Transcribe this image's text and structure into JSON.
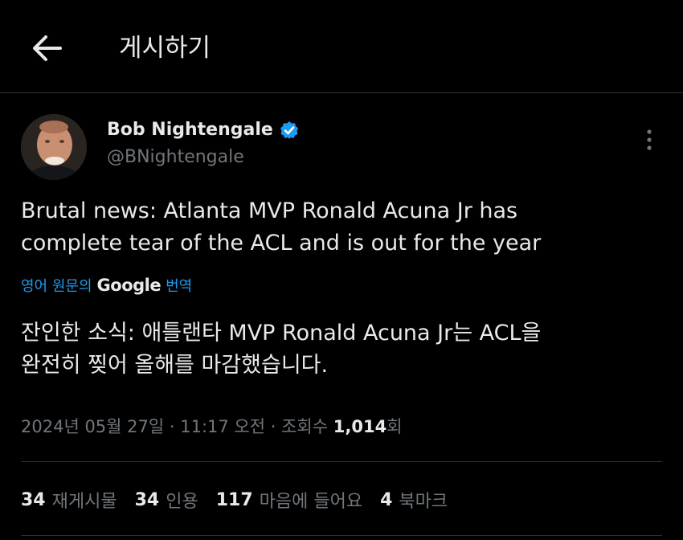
{
  "header": {
    "title": "게시하기",
    "back_icon": "arrow-left-icon"
  },
  "author": {
    "name": "Bob Nightengale",
    "handle": "@BNightengale",
    "verified_icon": "verified-badge-icon",
    "verified_color": "#1d9bf0"
  },
  "tweet": {
    "text_line1": "Brutal news: Atlanta MVP Ronald Acuna Jr has",
    "text_line2": "complete tear of the ACL and is out for the year"
  },
  "translation": {
    "prefix": "영어 원문의",
    "google": "Google",
    "suffix": "번역",
    "line1": "잔인한 소식: 애틀랜타 MVP Ronald Acuna Jr는 ACL을",
    "line2": "완전히 찢어 올해를 마감했습니다."
  },
  "meta": {
    "date": "2024년 05월 27일",
    "sep1": " · ",
    "time": "11:17 오전",
    "sep2": " · ",
    "views_label": "조회수 ",
    "views_count": "1,014",
    "views_suffix": "회"
  },
  "stats": {
    "reposts_count": "34",
    "reposts_label": "재게시물",
    "quotes_count": "34",
    "quotes_label": "인용",
    "likes_count": "117",
    "likes_label": "마음에 들어요",
    "bookmarks_count": "4",
    "bookmarks_label": "북마크"
  },
  "colors": {
    "background": "#000000",
    "text_primary": "#e7e9ea",
    "text_secondary": "#71767b",
    "link": "#1d9bf0",
    "divider": "#2f3336"
  }
}
